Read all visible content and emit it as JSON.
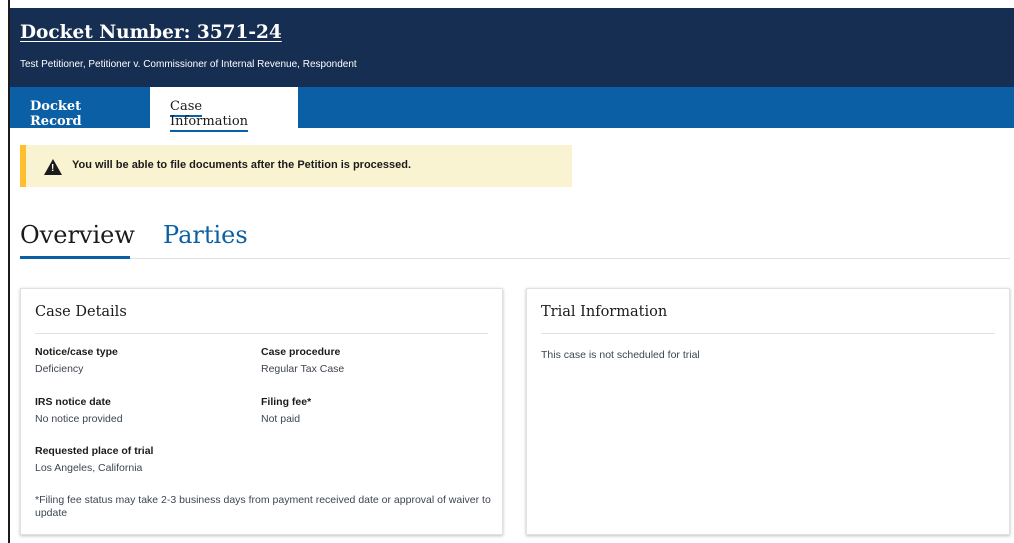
{
  "header": {
    "docket_title": "Docket Number: 3571-24",
    "case_caption": "Test Petitioner, Petitioner v. Commissioner of Internal Revenue, Respondent"
  },
  "tabs": [
    {
      "label": "Docket Record",
      "active": false
    },
    {
      "label": "Case Information",
      "active": true
    }
  ],
  "alert": {
    "icon": "warning-icon",
    "message": "You will be able to file documents after the Petition is processed."
  },
  "subtabs": [
    {
      "label": "Overview",
      "active": true
    },
    {
      "label": "Parties",
      "active": false
    }
  ],
  "case_details": {
    "title": "Case Details",
    "notice_type": {
      "label": "Notice/case type",
      "value": "Deficiency"
    },
    "case_procedure": {
      "label": "Case procedure",
      "value": "Regular Tax Case"
    },
    "irs_notice_date": {
      "label": "IRS notice date",
      "value": "No notice provided"
    },
    "filing_fee": {
      "label": "Filing fee*",
      "value": "Not paid"
    },
    "place_of_trial": {
      "label": "Requested place of trial",
      "value": "Los Angeles, California"
    },
    "footnote": "*Filing fee status may take 2-3 business days from payment received date or approval of waiver to update"
  },
  "trial_information": {
    "title": "Trial Information",
    "status": "This case is not scheduled for trial"
  },
  "colors": {
    "header_bg": "#162e51",
    "tabbar_bg": "#0b5fa5",
    "alert_bg": "#faf3d1",
    "alert_border": "#ffbe2e"
  }
}
